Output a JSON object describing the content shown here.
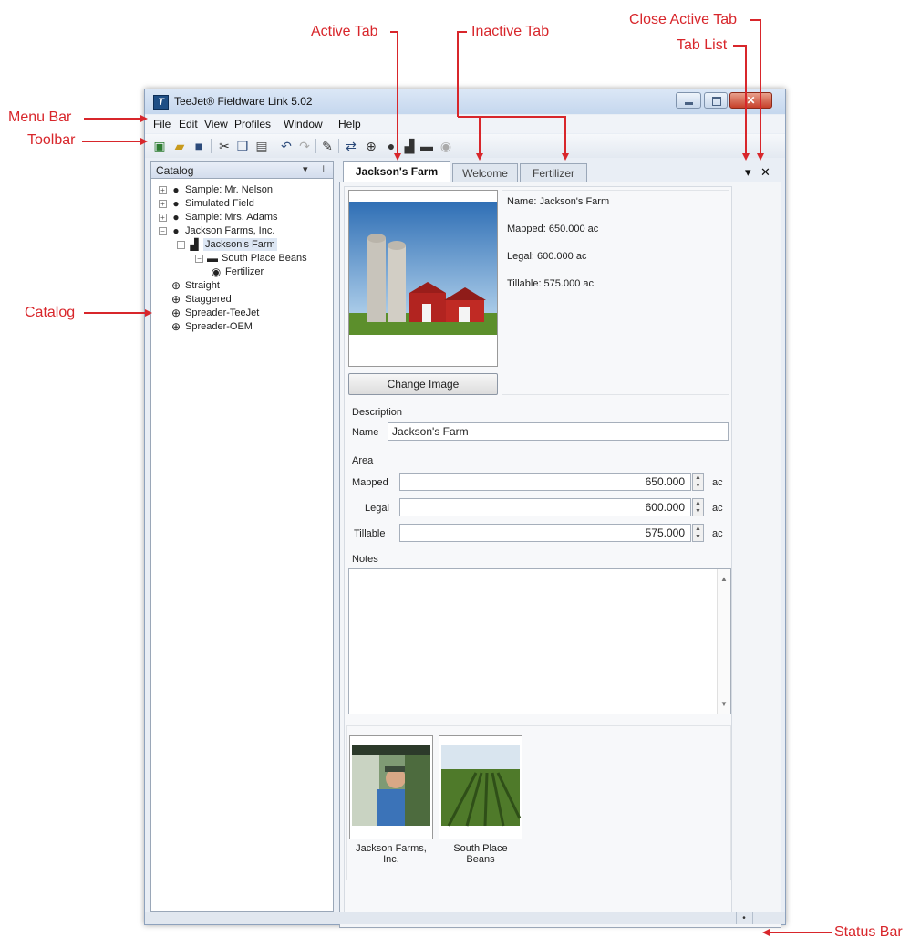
{
  "callouts": {
    "menu_bar": "Menu Bar",
    "toolbar": "Toolbar",
    "catalog": "Catalog",
    "active_tab": "Active Tab",
    "inactive_tab": "Inactive Tab",
    "close_active_tab": "Close Active Tab",
    "tab_list": "Tab List",
    "status_bar": "Status Bar"
  },
  "window": {
    "title": "TeeJet® Fieldware Link 5.02"
  },
  "menu": [
    "File",
    "Edit",
    "View",
    "Profiles",
    "Window",
    "Help"
  ],
  "catalog": {
    "title": "Catalog",
    "items": [
      {
        "label": "Sample: Mr. Nelson",
        "icon": "person-icon"
      },
      {
        "label": "Simulated Field",
        "icon": "person-icon"
      },
      {
        "label": "Sample: Mrs. Adams",
        "icon": "person-icon"
      },
      {
        "label": "Jackson Farms, Inc.",
        "icon": "person-icon"
      },
      {
        "label": "Jackson's Farm",
        "icon": "farm-icon"
      },
      {
        "label": "South Place Beans",
        "icon": "field-icon"
      },
      {
        "label": "Fertilizer",
        "icon": "product-icon"
      },
      {
        "label": "Straight",
        "icon": "steering-wheel-icon"
      },
      {
        "label": "Staggered",
        "icon": "steering-wheel-icon"
      },
      {
        "label": "Spreader-TeeJet",
        "icon": "steering-wheel-icon"
      },
      {
        "label": "Spreader-OEM",
        "icon": "steering-wheel-icon"
      }
    ]
  },
  "tabs": [
    {
      "label": "Jackson's Farm",
      "active": true
    },
    {
      "label": "Welcome",
      "active": false
    },
    {
      "label": "Fertilizer",
      "active": false
    }
  ],
  "farm": {
    "summary_name": "Name: Jackson's Farm",
    "summary_mapped": "Mapped: 650.000 ac",
    "summary_legal": "Legal: 600.000 ac",
    "summary_tillable": "Tillable: 575.000 ac",
    "change_image_label": "Change Image",
    "description_label": "Description",
    "name_label": "Name",
    "name_value": "Jackson's Farm",
    "area_label": "Area",
    "mapped_label": "Mapped",
    "mapped_value": "650.000",
    "legal_label": "Legal",
    "legal_value": "600.000",
    "tillable_label": "Tillable",
    "tillable_value": "575.000",
    "unit": "ac",
    "notes_label": "Notes",
    "notes_value": ""
  },
  "related": [
    {
      "caption": "Jackson Farms, Inc."
    },
    {
      "caption": "South Place Beans"
    }
  ],
  "status": {
    "indicator": "•"
  }
}
